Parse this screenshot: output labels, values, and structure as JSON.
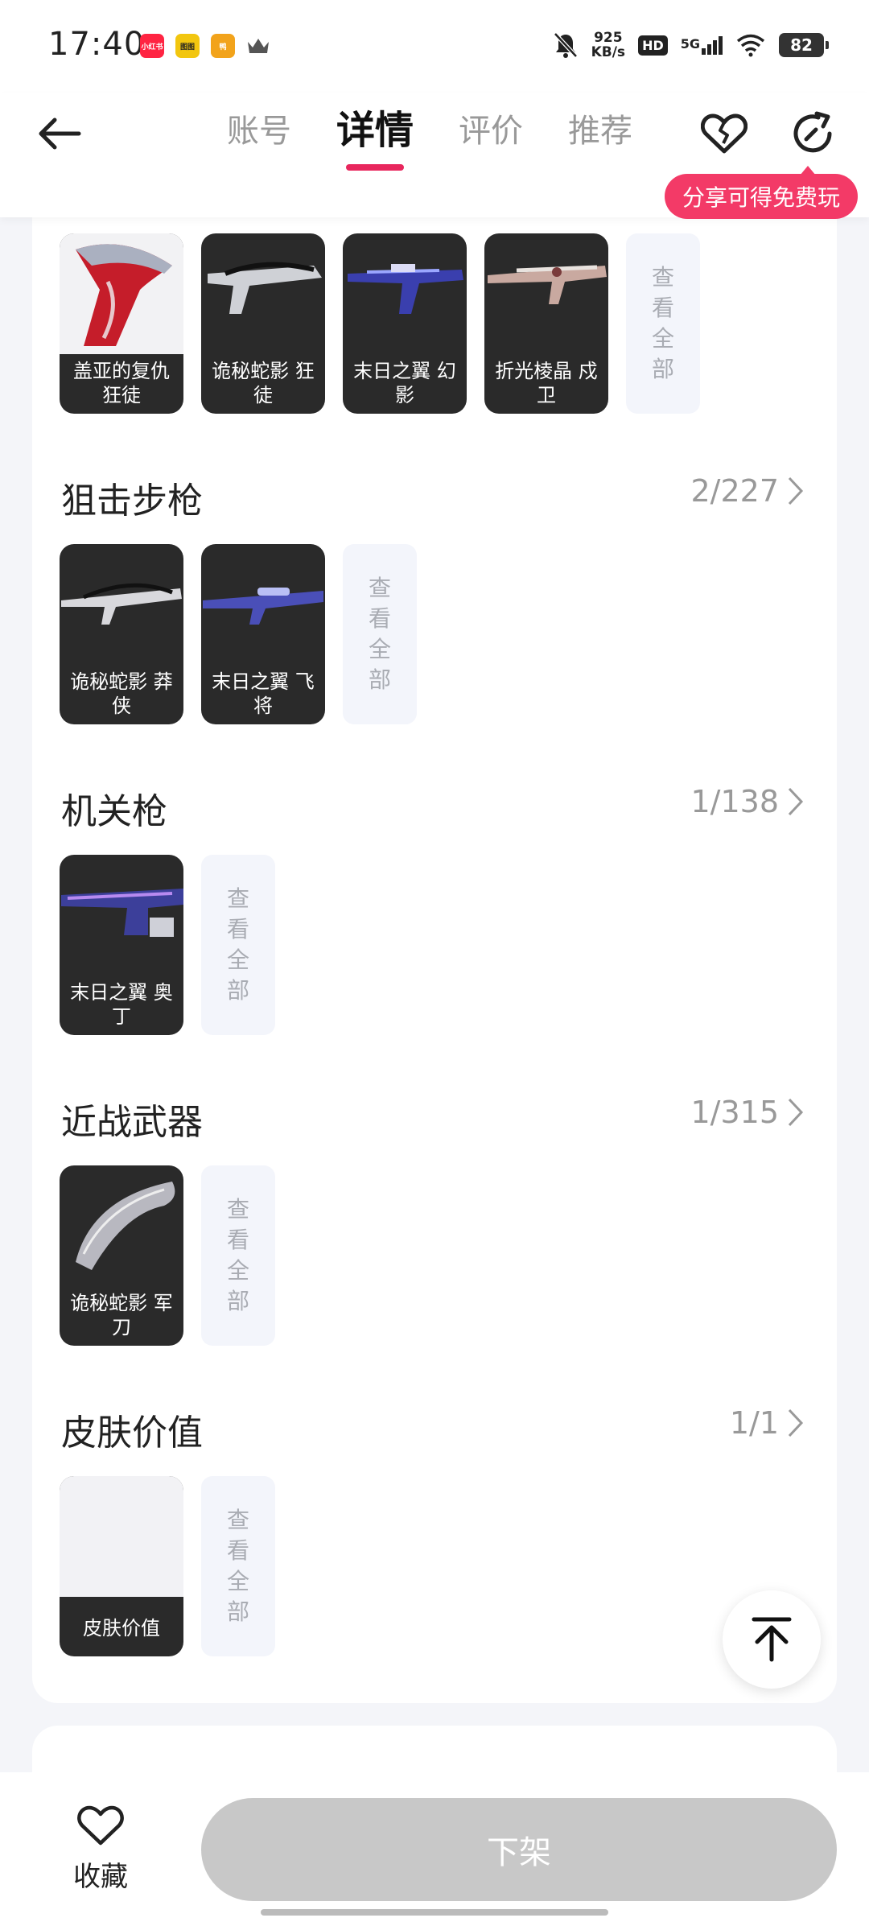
{
  "status_bar": {
    "time": "17:40",
    "apps": [
      {
        "name": "小红书",
        "color": "#ff2442"
      },
      {
        "name": "图图",
        "color": "#f2c60f"
      },
      {
        "name": "鸭",
        "color": "#f2a31b"
      }
    ],
    "net_speed_value": "925",
    "net_speed_unit": "KB/s",
    "hd_label": "HD",
    "signal_label": "5G",
    "battery": "82"
  },
  "header": {
    "tabs": [
      {
        "label": "账号",
        "active": false
      },
      {
        "label": "详情",
        "active": true
      },
      {
        "label": "评价",
        "active": false
      },
      {
        "label": "推荐",
        "active": false
      }
    ],
    "share_tip": "分享可得免费玩"
  },
  "top_row": {
    "items": [
      "盖亚的复仇 狂徒",
      "诡秘蛇影 狂徒",
      "末日之翼 幻影",
      "折光棱晶 戍卫"
    ],
    "view_all": "查看全部"
  },
  "sections": [
    {
      "title": "狙击步枪",
      "count": "2/227",
      "items": [
        "诡秘蛇影 莽侠",
        "末日之翼 飞将"
      ],
      "view_all": "查看全部"
    },
    {
      "title": "机关枪",
      "count": "1/138",
      "items": [
        "末日之翼 奥丁"
      ],
      "view_all": "查看全部"
    },
    {
      "title": "近战武器",
      "count": "1/315",
      "items": [
        "诡秘蛇影 军刀"
      ],
      "view_all": "查看全部"
    },
    {
      "title": "皮肤价值",
      "count": "1/1",
      "items": [
        "皮肤价值"
      ],
      "view_all": "查看全部"
    }
  ],
  "bottom_bar": {
    "favorite_label": "收藏",
    "delist_label": "下架"
  },
  "colors": {
    "accent": "#e8265d",
    "share_tip_bg": "#f33a67",
    "disabled_button": "#c8c8c8"
  }
}
